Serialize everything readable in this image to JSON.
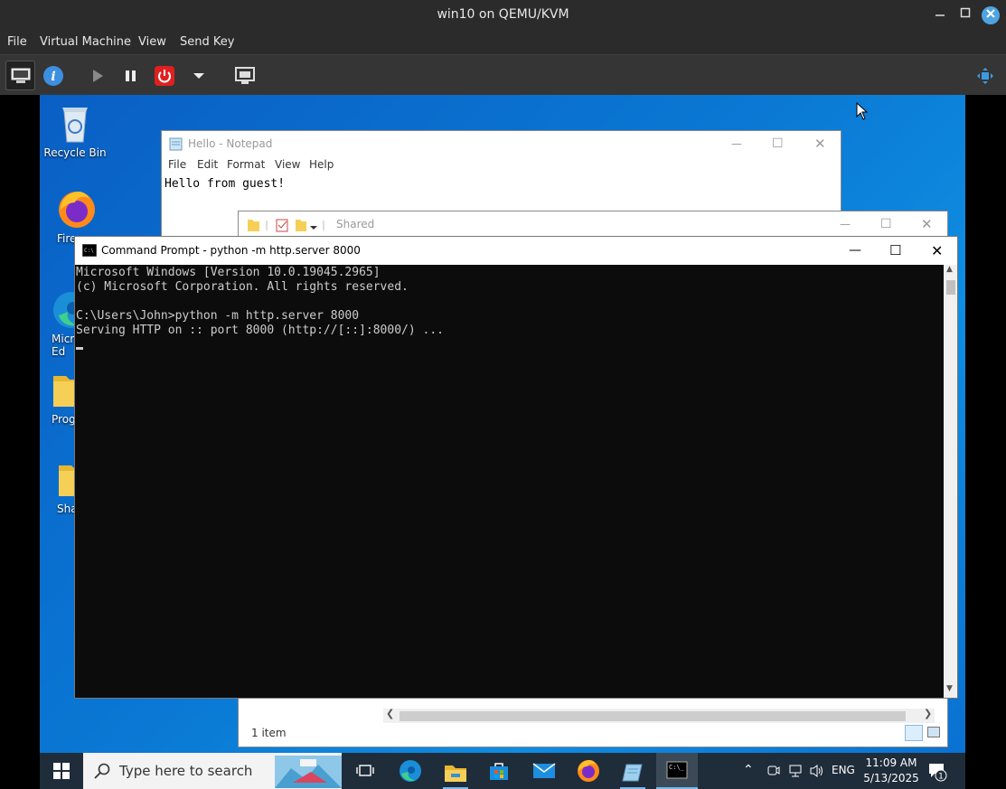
{
  "host": {
    "title": "win10 on QEMU/KVM",
    "menu": [
      "File",
      "Virtual Machine",
      "View",
      "Send Key"
    ],
    "toolbar": [
      "console-icon",
      "info-icon",
      "play-icon",
      "pause-icon",
      "power-icon",
      "dropdown-arrow-icon",
      "snapshot-icon",
      "resize-icon"
    ]
  },
  "desktop": {
    "icons": [
      {
        "label": "Recycle Bin",
        "icon": "recycle-bin-icon"
      },
      {
        "label": "Fire",
        "icon": "firefox-icon"
      },
      {
        "label": "Micr\nEd",
        "icon": "edge-icon"
      },
      {
        "label": "Prog",
        "icon": "folder-icon"
      },
      {
        "label": "Sha",
        "icon": "folder-icon"
      }
    ]
  },
  "notepad": {
    "title": "Hello - Notepad",
    "menu": [
      "File",
      "Edit",
      "Format",
      "View",
      "Help"
    ],
    "text": "Hello from guest!"
  },
  "explorer": {
    "title": "Shared",
    "status": "1 item"
  },
  "cmd": {
    "title": "Command Prompt - python  -m http.server 8000",
    "lines": [
      "Microsoft Windows [Version 10.0.19045.2965]",
      "(c) Microsoft Corporation. All rights reserved.",
      "",
      "C:\\Users\\John>python -m http.server 8000",
      "Serving HTTP on :: port 8000 (http://[::]:8000/) ..."
    ]
  },
  "taskbar": {
    "search_placeholder": "Type here to search",
    "lang": "ENG",
    "time": "11:09 AM",
    "date": "5/13/2025",
    "notification_count": "1"
  }
}
